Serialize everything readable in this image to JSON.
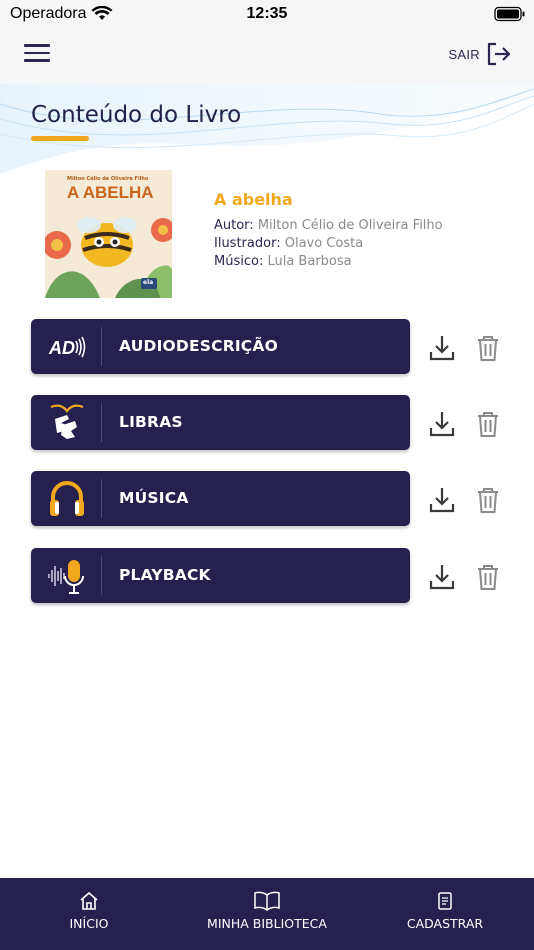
{
  "status_bar": {
    "carrier": "Operadora",
    "time": "12:35"
  },
  "header": {
    "logout_label": "SAIR"
  },
  "page": {
    "title": "Conteúdo do Livro"
  },
  "book": {
    "title": "A abelha",
    "author_label": "Autor:",
    "author": "Milton Célio de Oliveira Filho",
    "illustrator_label": "Ilustrador:",
    "illustrator": "Olavo Costa",
    "musician_label": "Músico:",
    "musician": "Lula Barbosa",
    "cover": {
      "author_line": "Milton Célio de Oliveira Filho",
      "title": "A ABELHA",
      "publisher": "ela"
    }
  },
  "media_items": [
    {
      "label": "AUDIODESCRIÇÃO",
      "icon": "audio-description-icon"
    },
    {
      "label": "LIBRAS",
      "icon": "sign-language-icon"
    },
    {
      "label": "MÚSICA",
      "icon": "headphones-icon"
    },
    {
      "label": "PLAYBACK",
      "icon": "microphone-icon"
    }
  ],
  "icons": {
    "ad_text": "AD"
  },
  "tabs": [
    {
      "label": "INÍCIO",
      "icon": "home-icon"
    },
    {
      "label": "MINHA BIBLIOTECA",
      "icon": "book-icon"
    },
    {
      "label": "CADASTRAR",
      "icon": "register-icon"
    }
  ],
  "colors": {
    "primary": "#25204d",
    "accent": "#f2a81d",
    "muted": "#8a8a8a"
  }
}
